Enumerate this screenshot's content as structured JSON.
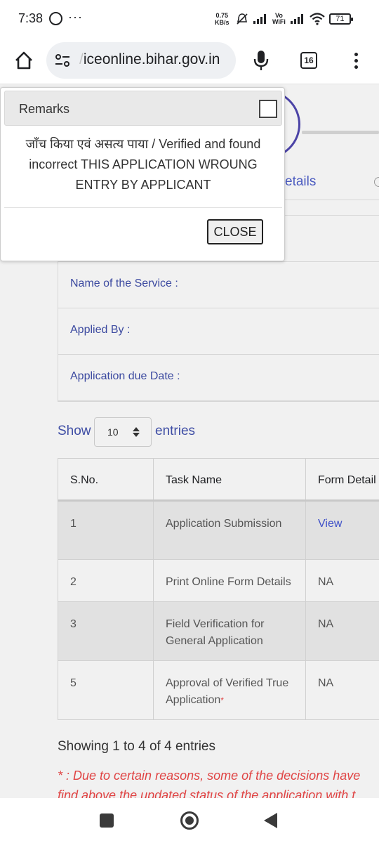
{
  "status_bar": {
    "time": "7:38",
    "more": "···",
    "speed_value": "0.75",
    "speed_unit": "KB/s",
    "vo": "Vo",
    "wifi": "WiFi",
    "battery": "71"
  },
  "browser": {
    "url_fade": "/",
    "url": "iceonline.bihar.gov.in",
    "tab_count": "16"
  },
  "page": {
    "tab_partial_label": "etails",
    "info": {
      "service_label": "Name of the Service :",
      "applied_by_label": "Applied By :",
      "due_date_label": "Application due Date :"
    },
    "show_label": "Show",
    "entries_value": "10",
    "entries_label": "entries",
    "table": {
      "headers": [
        "S.No.",
        "Task Name",
        "Form Detail"
      ],
      "rows": [
        {
          "sno": "1",
          "task": "Application Submission",
          "form": "View"
        },
        {
          "sno": "2",
          "task": "Print Online Form Details",
          "form": "NA"
        },
        {
          "sno": "3",
          "task": "Field Verification for General Application",
          "form": "NA"
        },
        {
          "sno": "5",
          "task": "Approval of Verified True Application",
          "asterisk": "*",
          "form": "NA"
        }
      ]
    },
    "showing": "Showing 1 to 4 of 4 entries",
    "note_line1": "* : Due to certain reasons, some of the decisions have",
    "note_line2": "find above the updated status of the application with t"
  },
  "modal": {
    "title": "Remarks",
    "body": "जाँच किया एवं असत्य पाया / Verified and found incorrect THIS APPLICATION WROUNG ENTRY BY APPLICANT",
    "close_label": "CLOSE"
  },
  "colors": {
    "accent": "#3f4ea5",
    "link": "#3f51c8",
    "note": "#e04444",
    "stepper": "#4b43a6"
  },
  "icons": [
    "home-icon",
    "tune-icon",
    "mic-icon",
    "tabs-icon",
    "menu-icon",
    "checkbox-icon",
    "sort-arrows-icon",
    "recents-icon",
    "home-circle-icon",
    "back-icon"
  ]
}
